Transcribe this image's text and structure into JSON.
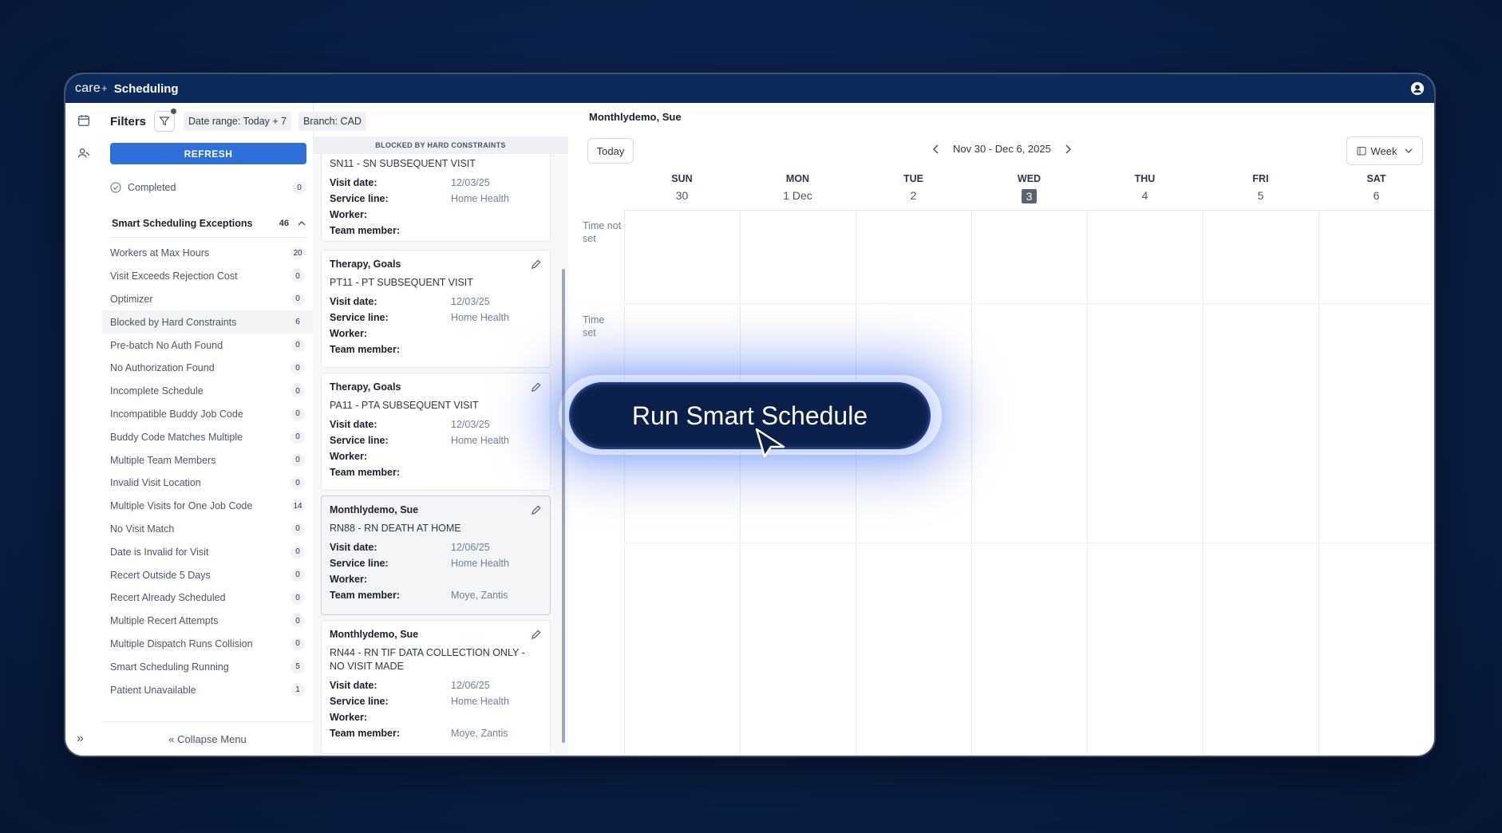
{
  "app": {
    "brand": "care",
    "brand_plus": "+",
    "title": "Scheduling"
  },
  "filters": {
    "title": "Filters",
    "date_range": "Date range: Today + 7",
    "branch": "Branch: CAD",
    "refresh_label": "REFRESH",
    "completed": {
      "label": "Completed",
      "count": "0"
    },
    "exceptions_title": "Smart Scheduling Exceptions",
    "exceptions_total": "46",
    "exceptions": [
      {
        "label": "Workers at Max Hours",
        "count": "20"
      },
      {
        "label": "Visit Exceeds Rejection Cost",
        "count": "0"
      },
      {
        "label": "Optimizer",
        "count": "0"
      },
      {
        "label": "Blocked by Hard Constraints",
        "count": "6"
      },
      {
        "label": "Pre-batch No Auth Found",
        "count": "0"
      },
      {
        "label": "No Authorization Found",
        "count": "0"
      },
      {
        "label": "Incomplete Schedule",
        "count": "0"
      },
      {
        "label": "Incompatible Buddy Job Code",
        "count": "0"
      },
      {
        "label": "Buddy Code Matches Multiple",
        "count": "0"
      },
      {
        "label": "Multiple Team Members",
        "count": "0"
      },
      {
        "label": "Invalid Visit Location",
        "count": "0"
      },
      {
        "label": "Multiple Visits for One Job Code",
        "count": "14"
      },
      {
        "label": "No Visit Match",
        "count": "0"
      },
      {
        "label": "Date is Invalid for Visit",
        "count": "0"
      },
      {
        "label": "Recert Outside 5 Days",
        "count": "0"
      },
      {
        "label": "Recert Already Scheduled",
        "count": "0"
      },
      {
        "label": "Multiple Recert Attempts",
        "count": "0"
      },
      {
        "label": "Multiple Dispatch Runs Collision",
        "count": "0"
      },
      {
        "label": "Smart Scheduling Running",
        "count": "5"
      },
      {
        "label": "Patient Unavailable",
        "count": "1"
      }
    ],
    "collapse_label": "Collapse Menu"
  },
  "visits": {
    "header": "BLOCKED BY HARD CONSTRAINTS",
    "labels": {
      "visit_date": "Visit date:",
      "service_line": "Service line:",
      "worker": "Worker:",
      "team_member": "Team member:"
    },
    "cards": [
      {
        "title": "",
        "code": "SN11 - SN SUBSEQUENT VISIT",
        "visit_date": "12/03/25",
        "service_line": "Home Health",
        "worker": "",
        "team_member": ""
      },
      {
        "title": "Therapy, Goals",
        "code": "PT11 - PT SUBSEQUENT VISIT",
        "visit_date": "12/03/25",
        "service_line": "Home Health",
        "worker": "",
        "team_member": ""
      },
      {
        "title": "Therapy, Goals",
        "code": "PA11 - PTA SUBSEQUENT VISIT",
        "visit_date": "12/03/25",
        "service_line": "Home Health",
        "worker": "",
        "team_member": ""
      },
      {
        "title": "Monthlydemo, Sue",
        "code": "RN88 - RN DEATH AT HOME",
        "visit_date": "12/06/25",
        "service_line": "Home Health",
        "worker": "",
        "team_member": "Moye, Zantis"
      },
      {
        "title": "Monthlydemo, Sue",
        "code": "RN44 - RN TIF DATA COLLECTION ONLY - NO VISIT MADE",
        "visit_date": "12/06/25",
        "service_line": "Home Health",
        "worker": "",
        "team_member": "Moye, Zantis"
      }
    ]
  },
  "calendar": {
    "patient": "Monthlydemo, Sue",
    "today_label": "Today",
    "range": "Nov 30 - Dec 6, 2025",
    "view_label": "Week",
    "days": [
      {
        "name": "SUN",
        "num": "30"
      },
      {
        "name": "MON",
        "num": "1 Dec"
      },
      {
        "name": "TUE",
        "num": "2"
      },
      {
        "name": "WED",
        "num": "3"
      },
      {
        "name": "THU",
        "num": "4"
      },
      {
        "name": "FRI",
        "num": "5"
      },
      {
        "name": "SAT",
        "num": "6"
      }
    ],
    "time_not_set": "Time not set",
    "time_set": "Time set"
  },
  "overlay": {
    "button_label": "Run Smart Schedule"
  }
}
